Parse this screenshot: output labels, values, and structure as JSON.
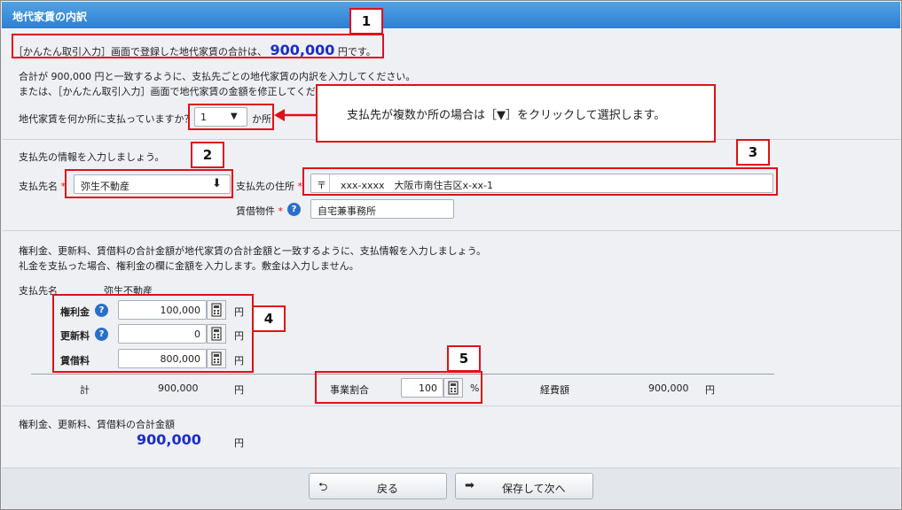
{
  "header": {
    "title": "地代家賃の内訳"
  },
  "intro": {
    "summary_prefix": "［かんたん取引入力］画面で登録した地代家賃の合計は、",
    "summary_amount": "900,000",
    "summary_suffix": "円です。",
    "line1": "合計が 900,000 円と一致するように、支払先ごとの地代家賃の内訳を入力してください。",
    "line2": "または、［かんたん取引入力］画面で地代家賃の金額を修正してくだ",
    "count_question": "地代家賃を何か所に支払っていますか？",
    "count_value": "1",
    "count_unit": "か所"
  },
  "callout": {
    "text": "支払先が複数か所の場合は［▼］をクリックして選択します。"
  },
  "payee": {
    "prompt": "支払先の情報を入力しましょう。",
    "name_label": "支払先名",
    "required_mark": "*",
    "name_value": "弥生不動産",
    "address_label": "支払先の住所",
    "postal_mark": "〒",
    "address_value": "xxx-xxxx　大阪市南住吉区x-xx-1",
    "property_label": "賃借物件",
    "property_value": "自宅兼事務所"
  },
  "amounts": {
    "instruction1": "権利金、更新料、賃借料の合計金額が地代家賃の合計金額と一致するように、支払情報を入力しましょう。",
    "instruction2": "礼金を支払った場合、権利金の欄に金額を入力します。敷金は入力しません。",
    "payee_header": "支払先名",
    "payee_name": "弥生不動産",
    "rows": [
      {
        "label": "権利金",
        "value": "100,000",
        "unit": "円"
      },
      {
        "label": "更新料",
        "value": "0",
        "unit": "円"
      },
      {
        "label": "賃借料",
        "value": "800,000",
        "unit": "円"
      }
    ],
    "total_label": "計",
    "total_value": "900,000",
    "total_unit": "円",
    "ratio_label": "事業割合",
    "ratio_value": "100",
    "ratio_unit": "%",
    "expense_label": "経費額",
    "expense_value": "900,000",
    "expense_unit": "円"
  },
  "grand_total": {
    "label": "権利金、更新料、賃借料の合計金額",
    "value": "900,000",
    "unit": "円"
  },
  "buttons": {
    "back": "戻る",
    "save_next": "保存して次へ"
  },
  "markers": [
    "1",
    "2",
    "3",
    "4",
    "5"
  ],
  "icons": {
    "help": "?",
    "dropdown": "▼",
    "download": "⬇",
    "back": "⮌",
    "forward": "➡"
  },
  "colors": {
    "accent_blue": "#1a2ec8",
    "highlight_red": "#e0101a",
    "title_bar": "#3b8ede"
  }
}
